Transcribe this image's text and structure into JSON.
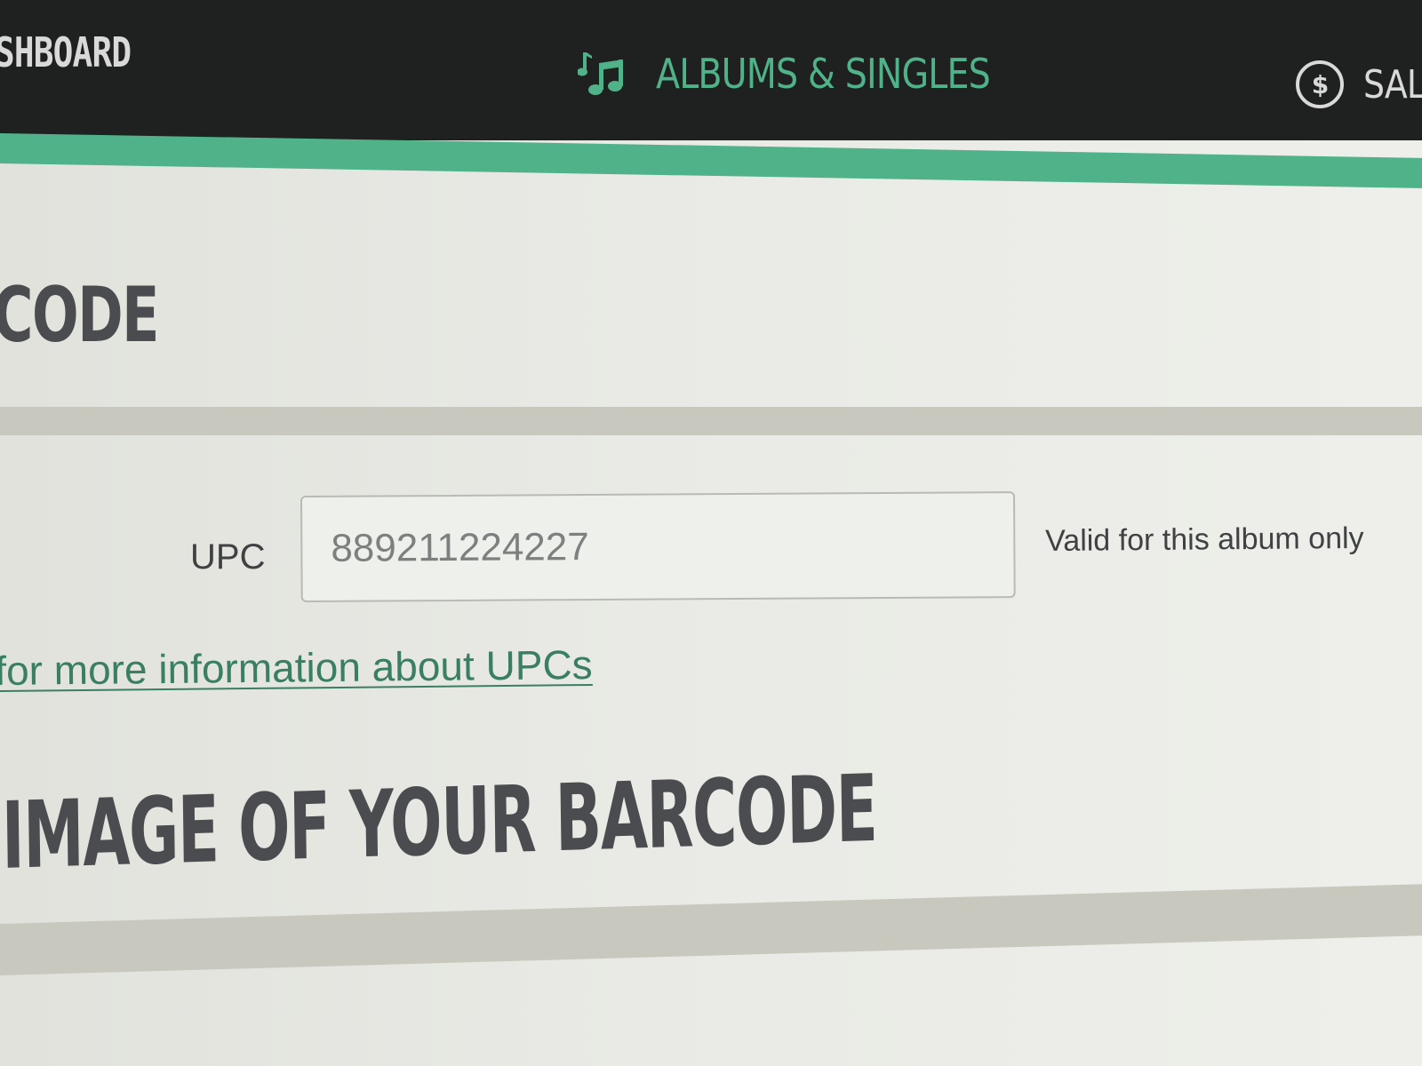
{
  "nav": {
    "dashboard_label": "SHBOARD",
    "albums_label": "ALBUMS & SINGLES",
    "sales_label": "SAL",
    "dollar_symbol": "$"
  },
  "colors": {
    "accent": "#4fb288",
    "topbar": "#1f2020",
    "heading": "#4a4c4f",
    "link": "#3a7f62"
  },
  "icons": {
    "albums": "music-note-icon",
    "sales": "dollar-circle-icon"
  },
  "barcode_section": {
    "title": "CODE",
    "upc_label": "UPC",
    "upc_value": "889211224227",
    "upc_help": "Valid for this album only",
    "info_link": "for more information about UPCs"
  },
  "image_section": {
    "title": "IMAGE OF YOUR BARCODE"
  }
}
